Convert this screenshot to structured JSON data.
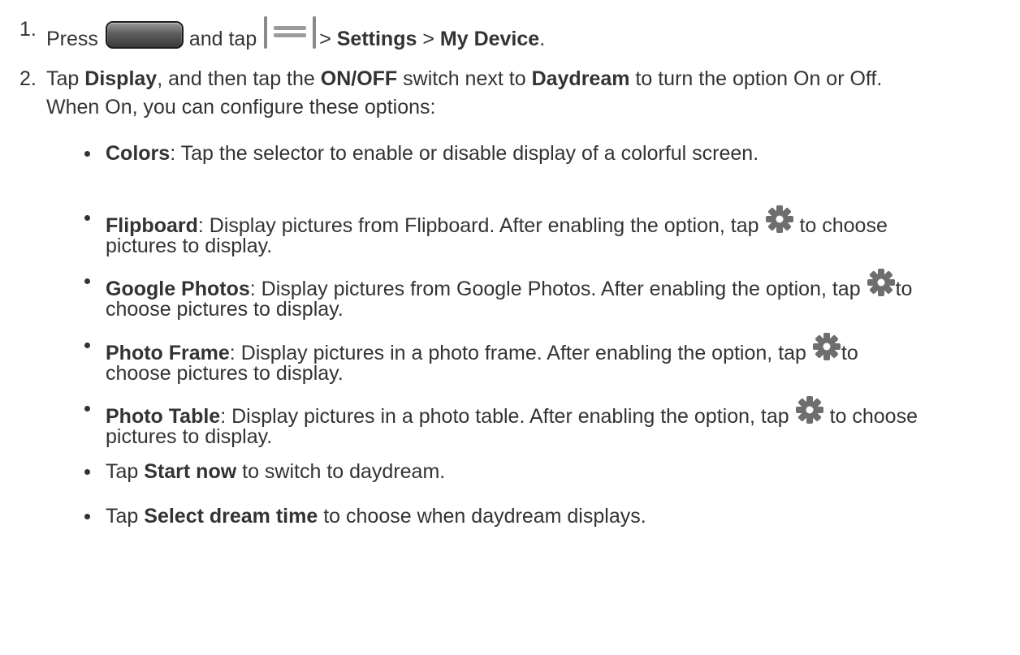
{
  "steps": [
    {
      "number": "1.",
      "parts": [
        "Press",
        "and tap",
        ">",
        "Settings",
        ">",
        "My Device",
        "."
      ],
      "icons": [
        "home-key-icon",
        "menu-key-icon"
      ]
    },
    {
      "number": "2.",
      "line1": [
        "Tap",
        "Display",
        ", and then tap the",
        "ON/OFF",
        "switch next to",
        "Daydream",
        "to turn the option On or Off."
      ],
      "line2": "When On, you can configure these options:"
    }
  ],
  "options": [
    {
      "name": "Colors",
      "text": ": Tap the selector to enable or disable display of a colorful screen."
    },
    {
      "name": "Flipboard",
      "line1": ": Display pictures from Flipboard. After enabling the option, tap",
      "line1_after": "to choose",
      "line2": "pictures to display.",
      "icon": "gear-icon"
    },
    {
      "name": "Google Photos",
      "line1": ": Display pictures from Google Photos. After enabling the option, tap",
      "line1_after": "to",
      "line2": "choose pictures to display.",
      "icon": "gear-icon"
    },
    {
      "name": "Photo Frame",
      "line1": ": Display pictures in a photo frame. After enabling the option, tap",
      "line1_after": "to",
      "line2": "choose pictures to display.",
      "icon": "gear-icon"
    },
    {
      "name": "Photo Table",
      "line1": ": Display pictures in a photo table. After enabling the option, tap",
      "line1_after": "to choose",
      "line2": "pictures to display.",
      "icon": "gear-icon"
    },
    {
      "pre": "Tap",
      "name": "Start now",
      "text": "to switch to daydream."
    },
    {
      "pre": "Tap",
      "name": "Select dream time",
      "text": "to choose when daydream displays."
    }
  ],
  "colors": {
    "text": "#333333",
    "gear": "#6e6e6e",
    "home_key": "#4a4a4a",
    "menu_key": "#9b9b9b"
  }
}
